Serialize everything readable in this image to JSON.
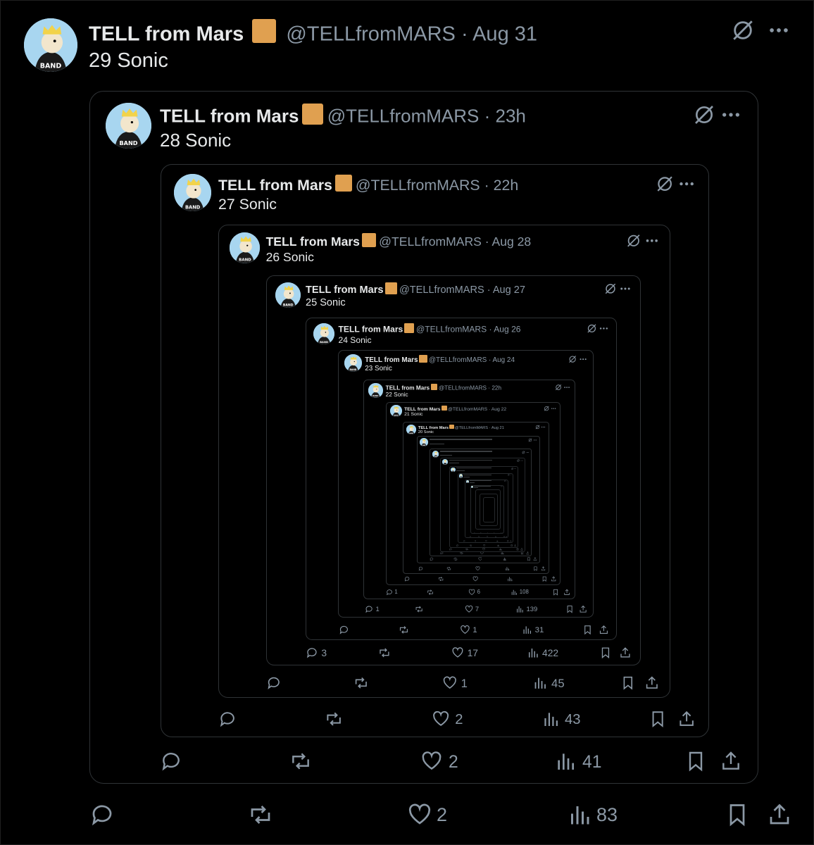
{
  "author": {
    "name": "TELL from Mars",
    "handle": "@TELLfromMARS",
    "avatar_label": "BAND"
  },
  "accent": "#e0a050",
  "tweets": [
    {
      "time": "Aug 31",
      "text": "29 Sonic",
      "replies": "",
      "likes": "2",
      "views": "83"
    },
    {
      "time": "23h",
      "text": "28 Sonic",
      "replies": "",
      "likes": "2",
      "views": "41"
    },
    {
      "time": "22h",
      "text": "27 Sonic",
      "replies": "",
      "likes": "2",
      "views": "43"
    },
    {
      "time": "Aug 28",
      "text": "26 Sonic",
      "replies": "",
      "likes": "1",
      "views": "45"
    },
    {
      "time": "Aug 27",
      "text": "25 Sonic",
      "replies": "3",
      "likes": "17",
      "views": "422"
    },
    {
      "time": "Aug 26",
      "text": "24 Sonic",
      "replies": "",
      "likes": "1",
      "views": "31"
    },
    {
      "time": "Aug 24",
      "text": "23 Sonic",
      "replies": "1",
      "likes": "7",
      "views": "139"
    },
    {
      "time": "22h",
      "text": "22 Sonic",
      "replies": "1",
      "likes": "6",
      "views": "108"
    },
    {
      "time": "Aug 22",
      "text": "21 Sonic",
      "replies": "",
      "likes": "",
      "views": ""
    },
    {
      "time": "Aug 21",
      "text": "20 Sonic",
      "replies": "",
      "likes": "",
      "views": ""
    }
  ],
  "icons": [
    "grok-icon",
    "more-icon",
    "reply-icon",
    "retweet-icon",
    "like-icon",
    "views-icon",
    "bookmark-icon",
    "share-icon"
  ]
}
